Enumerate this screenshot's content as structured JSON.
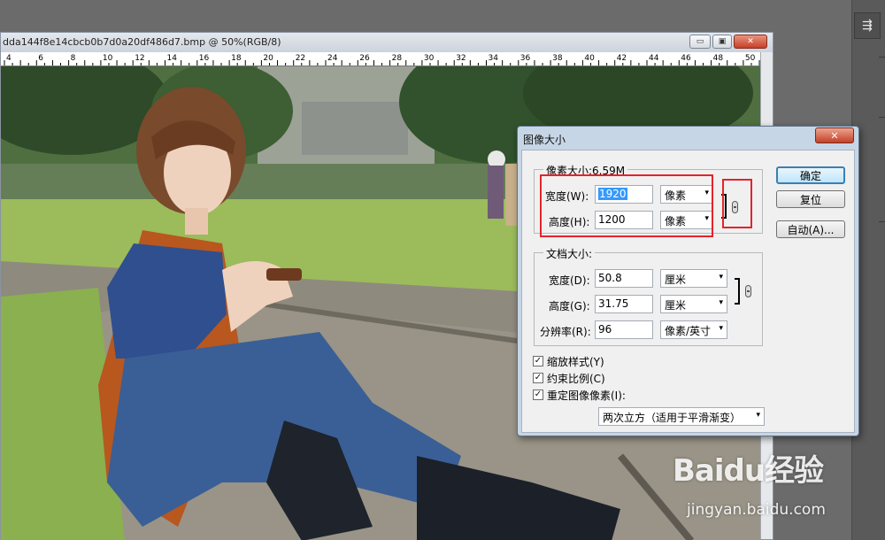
{
  "document": {
    "title": "dda144f8e14cbcb0b7d0a20df486d7.bmp @ 50%(RGB/8)",
    "ruler_ticks": [
      "4",
      "6",
      "8",
      "10",
      "12",
      "14",
      "16",
      "18",
      "20",
      "22",
      "24",
      "26",
      "28",
      "30",
      "32",
      "34",
      "36",
      "38",
      "40",
      "42",
      "44",
      "46",
      "48",
      "50"
    ],
    "window_buttons": {
      "minimize": "▭",
      "restore": "▣",
      "close": "✕"
    }
  },
  "dialog": {
    "title": "图像大小",
    "close_symbol": "✕",
    "pixel_dimensions": {
      "legend": "像素大小:6.59M",
      "width_label": "宽度(W):",
      "width_value": "1920",
      "width_unit": "像素",
      "height_label": "高度(H):",
      "height_value": "1200",
      "height_unit": "像素"
    },
    "document_size": {
      "legend": "文档大小:",
      "width_label": "宽度(D):",
      "width_value": "50.8",
      "width_unit": "厘米",
      "height_label": "高度(G):",
      "height_value": "31.75",
      "height_unit": "厘米",
      "resolution_label": "分辨率(R):",
      "resolution_value": "96",
      "resolution_unit": "像素/英寸"
    },
    "buttons": {
      "ok": "确定",
      "reset": "复位",
      "auto": "自动(A)..."
    },
    "checkboxes": [
      {
        "label": "缩放样式(Y)",
        "checked": true
      },
      {
        "label": "约束比例(C)",
        "checked": true
      },
      {
        "label": "重定图像像素(I):",
        "checked": true
      }
    ],
    "resample_method": "两次立方（适用于平滑渐变）",
    "check_mark": "✓",
    "dropdown_arrow": "▾"
  },
  "side_panel": {
    "icon": "panel-toggle-icon",
    "glyph": "⇶"
  },
  "watermark": {
    "brand": "Baidu经验",
    "url": "jingyan.baidu.com"
  }
}
